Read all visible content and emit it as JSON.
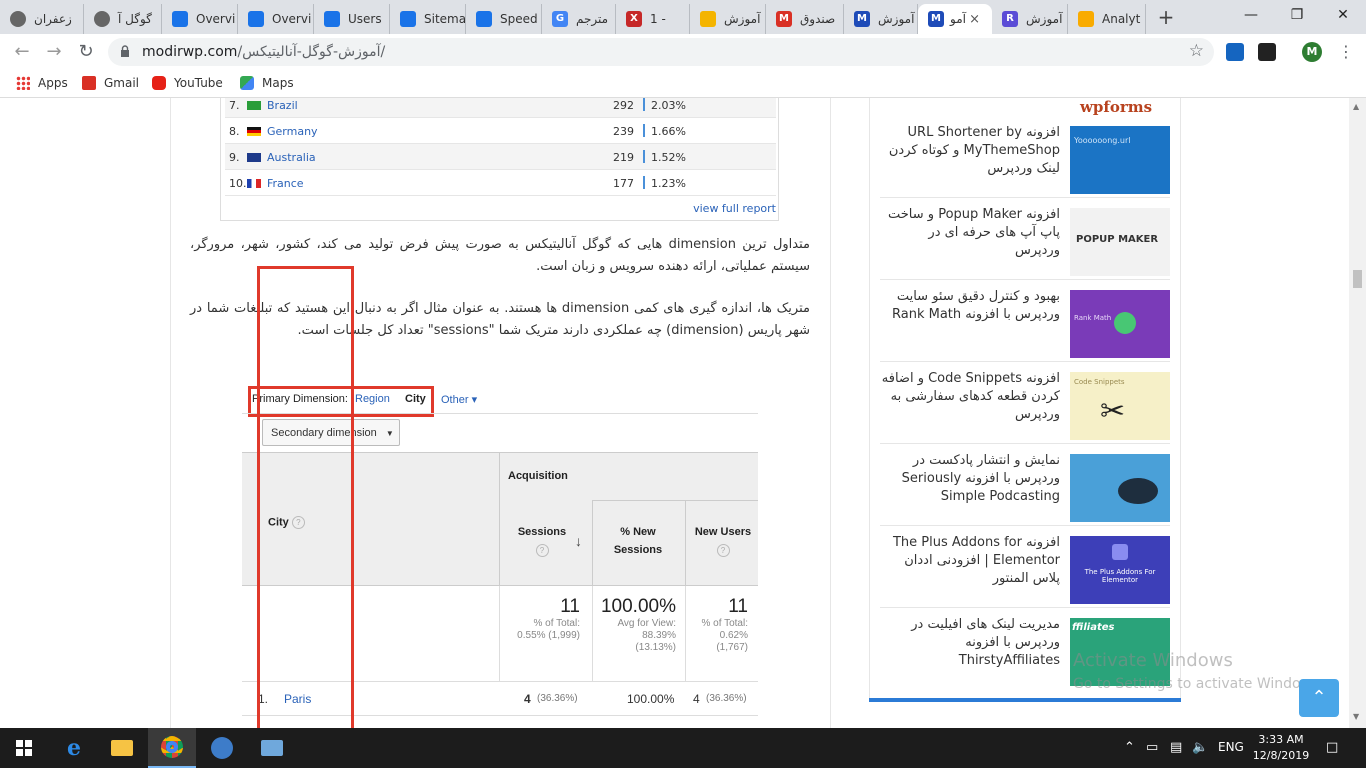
{
  "browser": {
    "tabs": [
      {
        "label": "زعفران",
        "color": "#555"
      },
      {
        "label": "گوگل آ",
        "color": "#555"
      },
      {
        "label": "Overvi",
        "color": "#1a73e8"
      },
      {
        "label": "Overvi",
        "color": "#1a73e8"
      },
      {
        "label": "Users",
        "color": "#1a73e8"
      },
      {
        "label": "Sitema",
        "color": "#1a73e8"
      },
      {
        "label": "Speed",
        "color": "#1a73e8"
      },
      {
        "label": "مترجم",
        "color": "#4285f4"
      },
      {
        "label": "1 -",
        "color": "#c62828"
      },
      {
        "label": "آموزش",
        "color": "#f4b400"
      },
      {
        "label": "صندوق",
        "color": "#d93025"
      },
      {
        "label": "آموزش",
        "color": "#1e4bb8"
      },
      {
        "label": "آمو",
        "color": "#1e4bb8"
      },
      {
        "label": "آموزش",
        "color": "#5b4cd6"
      },
      {
        "label": "Analyt",
        "color": "#f9ab00"
      }
    ],
    "active_tab_close": "×",
    "new_tab": "+",
    "url_host": "modirwp.com",
    "url_path": "/آموزش-گوگل-آنالیتیکس/",
    "profile_initial": "M",
    "bookmarks": [
      "Apps",
      "Gmail",
      "YouTube",
      "Maps"
    ]
  },
  "country_table": {
    "rows": [
      {
        "num": "7.",
        "country": "Brazil",
        "value": "292",
        "pct": "2.03%",
        "flag": "br"
      },
      {
        "num": "8.",
        "country": "Germany",
        "value": "239",
        "pct": "1.66%",
        "flag": "de"
      },
      {
        "num": "9.",
        "country": "Australia",
        "value": "219",
        "pct": "1.52%",
        "flag": "au"
      },
      {
        "num": "10.",
        "country": "France",
        "value": "177",
        "pct": "1.23%",
        "flag": "fr"
      }
    ],
    "view_full": "view full report"
  },
  "paragraphs": {
    "p1": "متداول ترین dimension هایی که گوگل آنالیتیکس به صورت پیش فرض تولید می کند، کشور، شهر، مرورگر، سیستم عملیاتی، ارائه دهنده سرویس و زبان است.",
    "p2": "متریک ها، اندازه گیری های کمی dimension ها هستند. به عنوان مثال اگر به دنبال این هستید که تبلیغات شما در شهر پاریس (dimension) چه عملکردی دارند متریک شما \"sessions\" تعداد کل جلسات است."
  },
  "ga": {
    "primary_dimension_label": "Primary Dimension:",
    "region": "Region",
    "city": "City",
    "other": "Other ▾",
    "secondary_dimension": "Secondary dimension",
    "col_city": "City",
    "acquisition": "Acquisition",
    "col_sessions": "Sessions",
    "col_new_sessions_1": "% New",
    "col_new_sessions_2": "Sessions",
    "col_new_users": "New Users",
    "totals": {
      "sessions": "11",
      "sessions_sub1": "% of Total:",
      "sessions_sub2": "0.55% (1,999)",
      "new_sessions": "100.00%",
      "new_sessions_sub1": "Avg for View:",
      "new_sessions_sub2": "88.39%",
      "new_sessions_sub3": "(13.13%)",
      "new_users": "11",
      "new_users_sub1": "% of Total:",
      "new_users_sub2": "0.62%",
      "new_users_sub3": "(1,767)"
    },
    "row1": {
      "num": "1.",
      "city": "Paris",
      "sessions": "4",
      "sessions_pct": "(36.36%)",
      "new_sessions": "100.00%",
      "new_users": "4",
      "new_users_pct": "(36.36%)"
    }
  },
  "sidebar": {
    "wpforms": "wpforms",
    "items": [
      {
        "title": "افزونه URL Shortener by MyThemeShop و کوتاه کردن لینک وردپرس",
        "thumb_color": "#1b74c5",
        "thumb_text": "Yoooooong.url"
      },
      {
        "title": "افزونه Popup Maker و ساخت پاپ آپ های حرفه ای در وردپرس",
        "thumb_color": "#f2f2f2",
        "thumb_text": "POPUP MAKER"
      },
      {
        "title": "بهبود و کنترل دقیق سئو سایت وردپرس با افزونه Rank Math",
        "thumb_color": "#7a3bb8",
        "thumb_text": "Rank Math"
      },
      {
        "title": "افزونه Code Snippets و اضافه کردن قطعه کدهای سفارشی به وردپرس",
        "thumb_color": "#f6f0c8",
        "thumb_text": "Code Snippets"
      },
      {
        "title": "نمایش و انتشار پادکست در وردپرس با افزونه Seriously Simple Podcasting",
        "thumb_color": "#4aa0d8",
        "thumb_text": ""
      },
      {
        "title": "افزونه The Plus Addons for Elementor | افزودنی اددان پلاس المنتور",
        "thumb_color": "#3d3fb8",
        "thumb_text": "The Plus Addons For Elementor"
      },
      {
        "title": "مدیریت لینک های افیلیت در وردپرس با افزونه ThirstyAffiliates",
        "thumb_color": "#2aa37a",
        "thumb_text": "ffiliates"
      }
    ]
  },
  "watermark": {
    "line1": "Activate Windows",
    "line2": "Go to Settings to activate Windows."
  },
  "taskbar": {
    "time": "3:33 AM",
    "date": "12/8/2019",
    "lang": "ENG"
  }
}
